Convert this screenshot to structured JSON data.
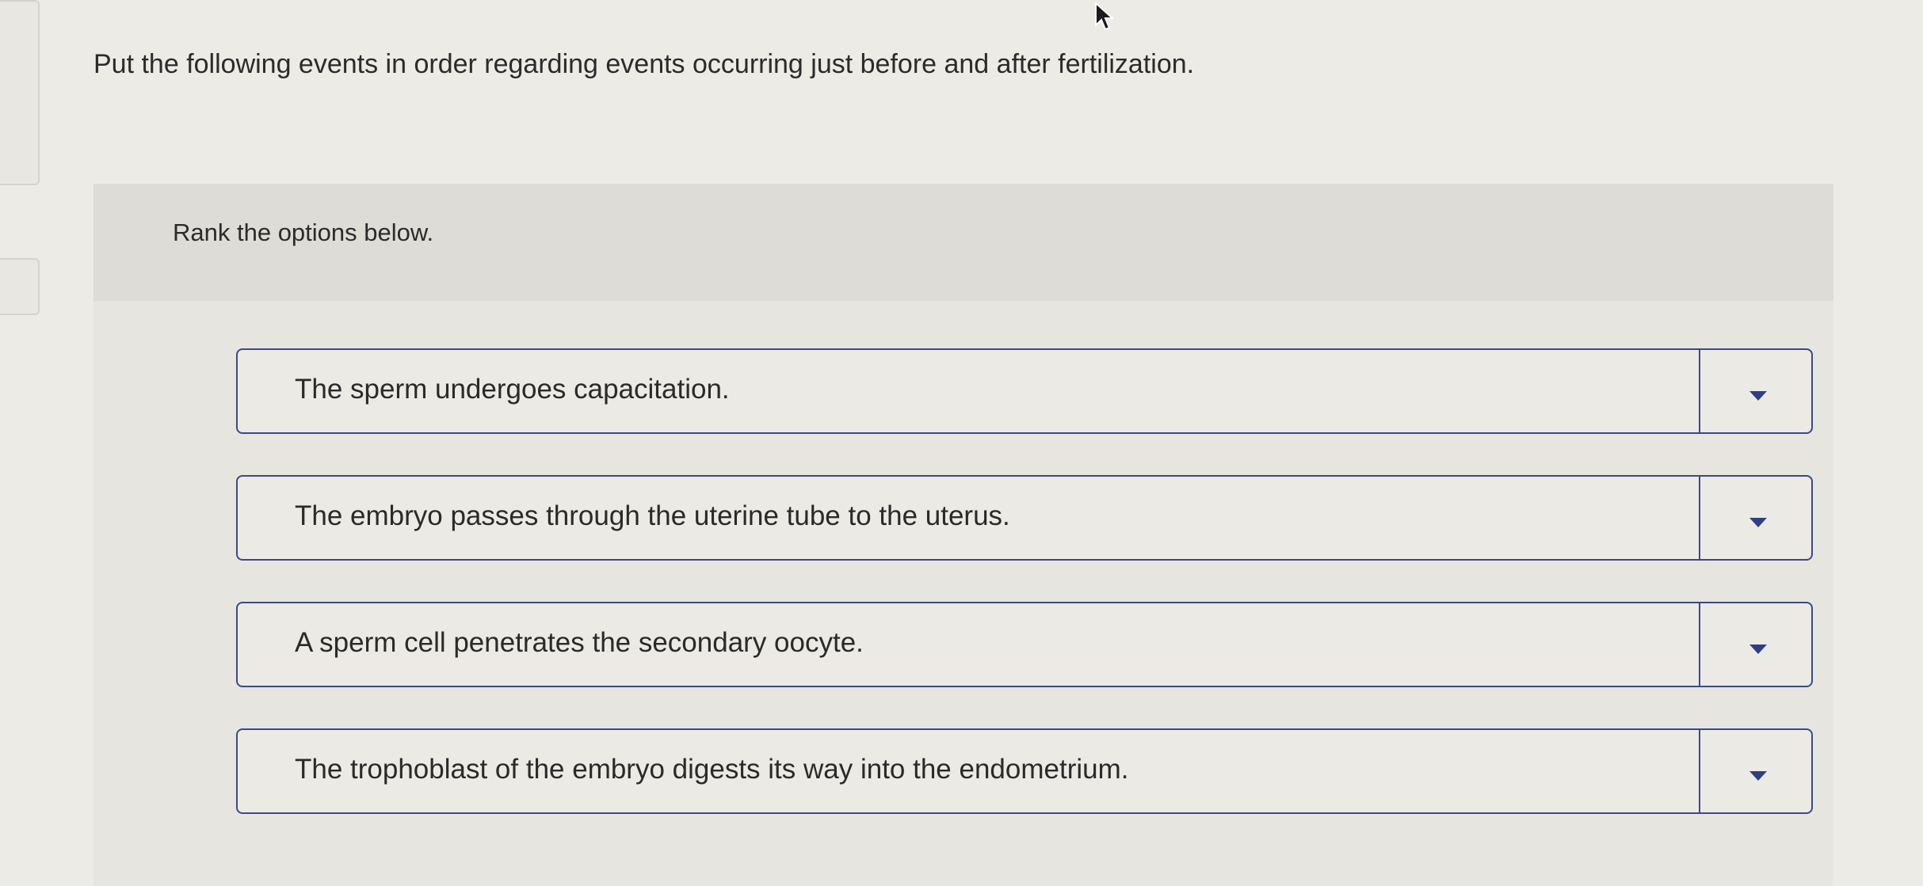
{
  "question": {
    "text": "Put the following events in order regarding events occurring just before and after fertilization."
  },
  "ranking": {
    "instruction": "Rank the options below.",
    "items": [
      {
        "label": "The sperm undergoes capacitation.",
        "selected_rank": ""
      },
      {
        "label": "The embryo passes through the uterine tube to the uterus.",
        "selected_rank": ""
      },
      {
        "label": "A sperm cell penetrates the secondary oocyte.",
        "selected_rank": ""
      },
      {
        "label": "The trophoblast of the embryo digests its way into the endometrium.",
        "selected_rank": ""
      }
    ]
  },
  "icons": {
    "dropdown": "chevron-down-icon",
    "cursor": "mouse-pointer-icon"
  },
  "colors": {
    "accent": "#3a4a8a",
    "caret": "#2e3f86",
    "page_background": "#ecebe6",
    "panel_header": "#dddcd7"
  }
}
